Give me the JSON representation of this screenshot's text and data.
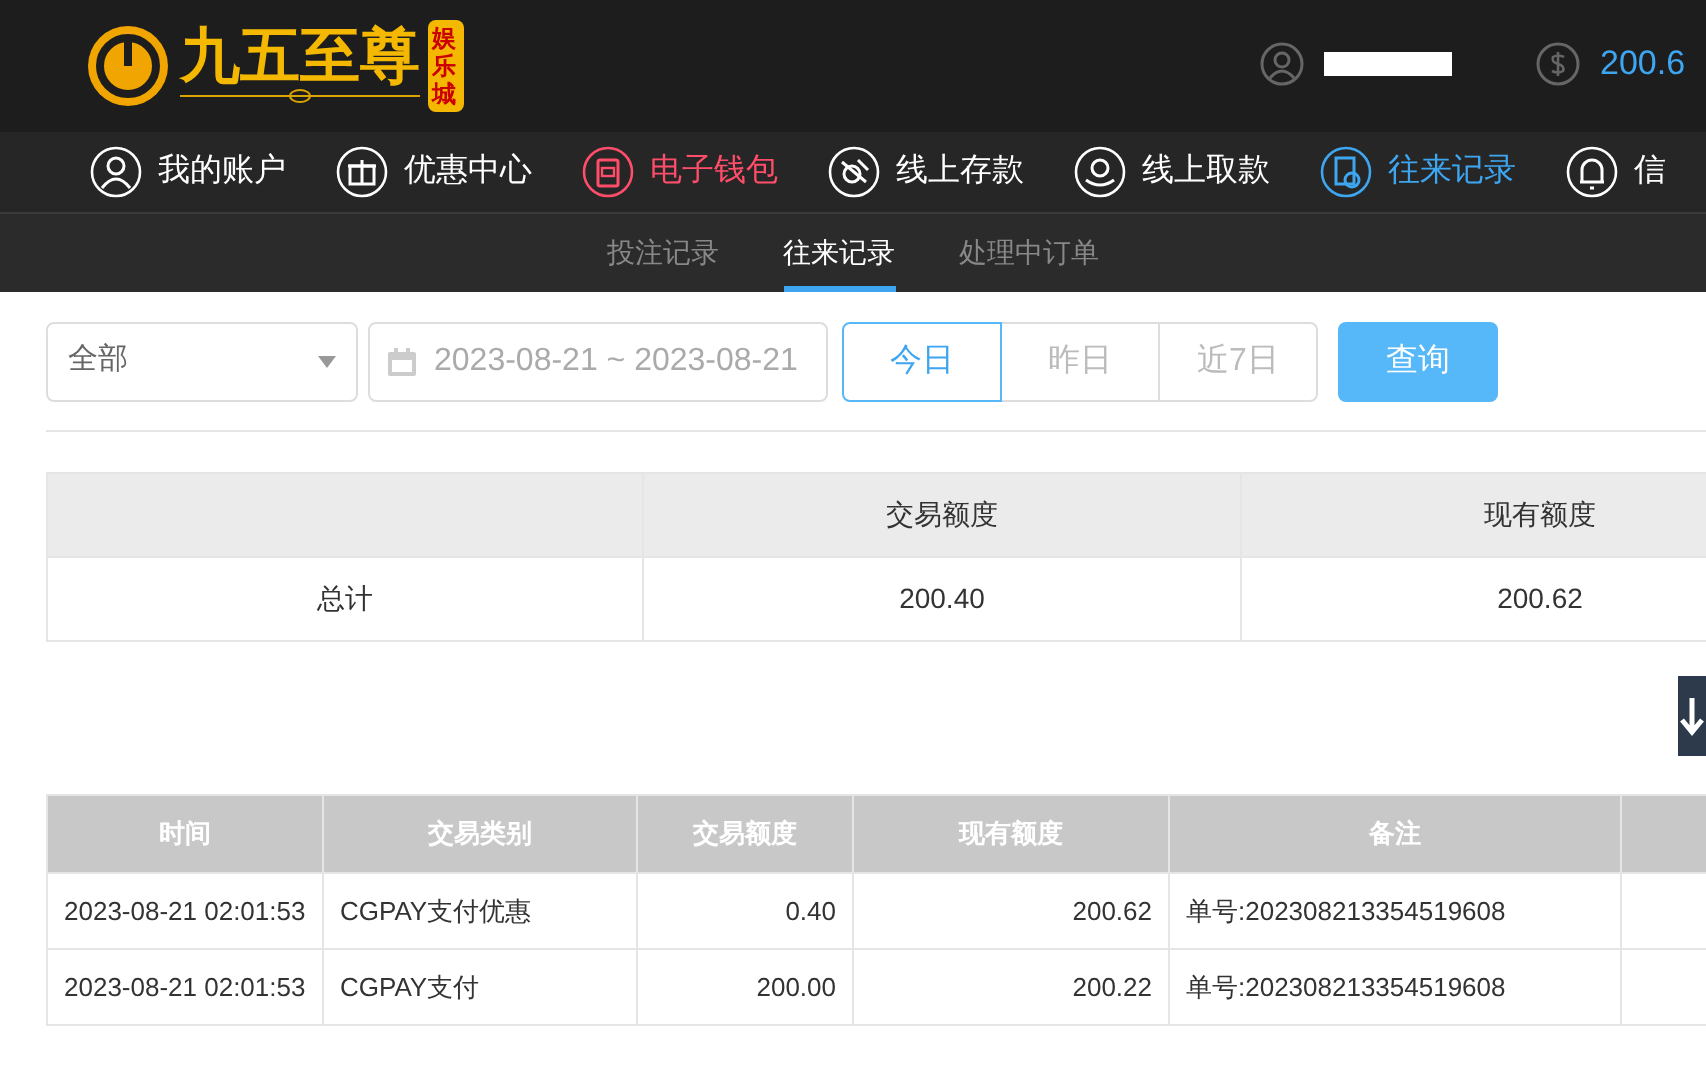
{
  "header": {
    "logo": {
      "text": "九五至尊",
      "badge": "娱乐城"
    },
    "balance": "200.6"
  },
  "nav": [
    {
      "label": "我的账户",
      "selected": false,
      "highlighted": false
    },
    {
      "label": "优惠中心",
      "selected": false,
      "highlighted": false
    },
    {
      "label": "电子钱包",
      "selected": false,
      "highlighted": true
    },
    {
      "label": "线上存款",
      "selected": false,
      "highlighted": false
    },
    {
      "label": "线上取款",
      "selected": false,
      "highlighted": false
    },
    {
      "label": "往来记录",
      "selected": true,
      "highlighted": false
    },
    {
      "label": "信",
      "selected": false,
      "highlighted": false
    }
  ],
  "subtabs": [
    {
      "label": "投注记录",
      "selected": false
    },
    {
      "label": "往来记录",
      "selected": true
    },
    {
      "label": "处理中订单",
      "selected": false
    }
  ],
  "filters": {
    "type_select": "全部",
    "date_range": "2023-08-21 ~ 2023-08-21",
    "quick_ranges": [
      {
        "label": "今日",
        "selected": true
      },
      {
        "label": "昨日",
        "selected": false
      },
      {
        "label": "近7日",
        "selected": false
      }
    ],
    "query_button": "查询"
  },
  "summary": {
    "columns": [
      "交易额度",
      "现有额度"
    ],
    "rows": [
      {
        "label": "总计",
        "values": [
          "200.40",
          "200.62"
        ]
      }
    ]
  },
  "records": {
    "columns": [
      "时间",
      "交易类别",
      "交易额度",
      "现有额度",
      "备注"
    ],
    "rows": [
      [
        "2023-08-21 02:01:53",
        "CGPAY支付优惠",
        "0.40",
        "200.62",
        "单号:202308213354519608"
      ],
      [
        "2023-08-21 02:01:53",
        "CGPAY支付",
        "200.00",
        "200.22",
        "单号:202308213354519608"
      ]
    ]
  }
}
